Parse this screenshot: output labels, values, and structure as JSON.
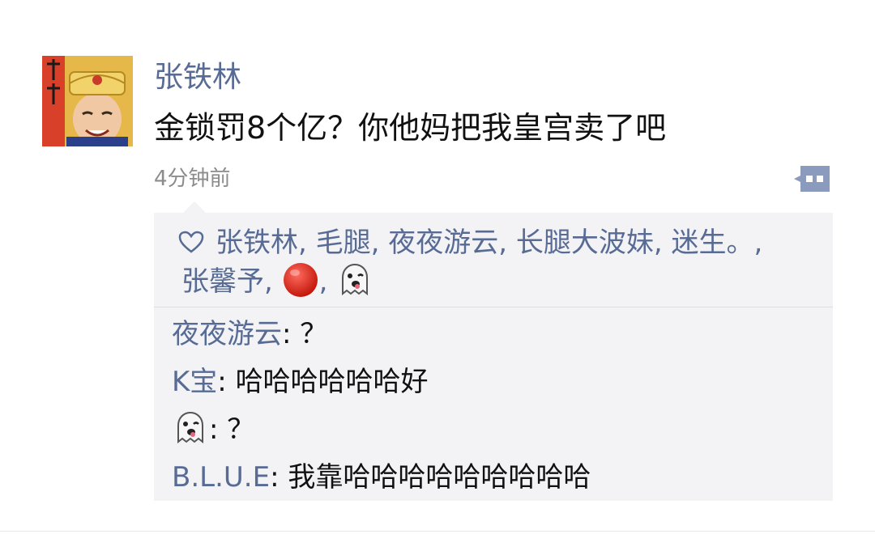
{
  "post": {
    "author": "张铁林",
    "content": "金锁罚8个亿？你他妈把我皇宫卖了吧",
    "time": "4分钟前",
    "avatar_icon": "emperor-avatar"
  },
  "likes": {
    "icon": "heart-outline-icon",
    "names_line1": [
      "张铁林",
      "毛腿",
      "夜夜游云",
      "长腿大波妹",
      "迷生。"
    ],
    "names_line2": [
      "张馨予"
    ],
    "emoji_names": [
      "red-circle-icon",
      "ghost-icon"
    ],
    "separator": ", "
  },
  "comments": [
    {
      "author": "夜夜游云",
      "colon": ": ",
      "text": "？"
    },
    {
      "author": "K宝",
      "colon": ": ",
      "text": "哈哈哈哈哈哈好"
    },
    {
      "author_icon": "ghost-icon",
      "colon": ": ",
      "text": "？"
    },
    {
      "author": "B.L.U.E",
      "colon": ": ",
      "text": "我靠哈哈哈哈哈哈哈哈哈"
    }
  ],
  "colors": {
    "name_blue": "#576b95",
    "panel_bg": "#f3f3f5",
    "time_gray": "#8c8c8c"
  }
}
